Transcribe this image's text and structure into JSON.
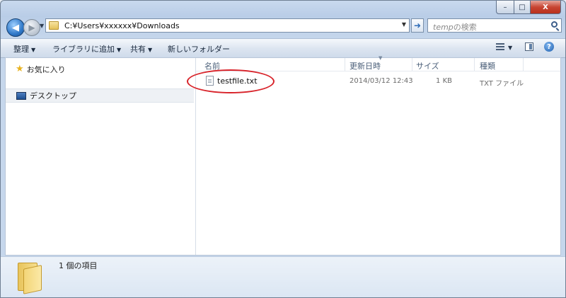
{
  "caption": {
    "minimize": "–",
    "maximize": "□",
    "close": "X"
  },
  "nav": {
    "back_glyph": "◀",
    "forward_glyph": "▶",
    "address_path": "C:¥Users¥xxxxxx¥Downloads",
    "go_glyph": "➜",
    "search_folder": "temp",
    "search_suffix": "の検索"
  },
  "commandbar": {
    "organize": "整理",
    "include_in_library": "ライブラリに追加",
    "share": "共有",
    "new_folder": "新しいフォルダー",
    "help": "?"
  },
  "navpane": {
    "favorites": "お気に入り",
    "desktop": "デスクトップ"
  },
  "columns": {
    "name": "名前",
    "date_modified": "更新日時",
    "size": "サイズ",
    "type": "種類"
  },
  "files": [
    {
      "name": "testfile.txt",
      "date": "2014/03/12 12:43",
      "size": "1 KB",
      "type": "TXT ファイル"
    }
  ],
  "details": {
    "count": "1 個の項目"
  },
  "colors": {
    "highlight_ellipse": "#d8232a"
  }
}
